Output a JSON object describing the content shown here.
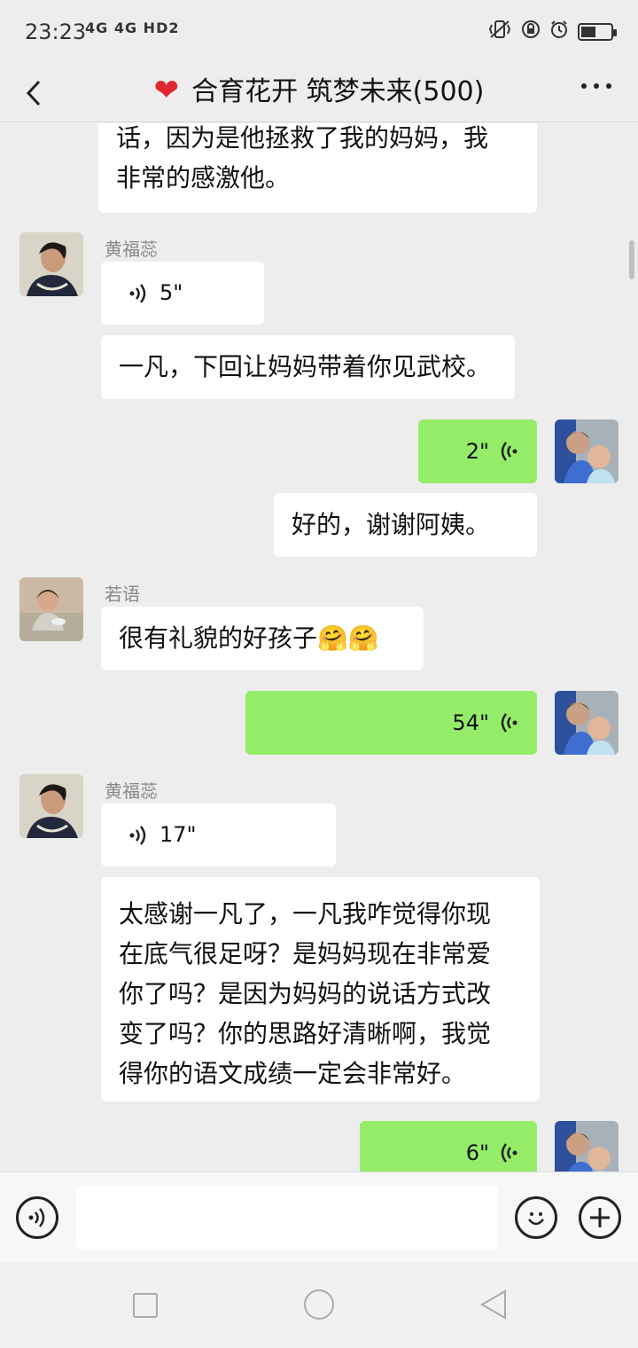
{
  "status_bar": {
    "time": "23:23",
    "network": "4G 4G HD2"
  },
  "header": {
    "title": "合育花开 筑梦未来(500)",
    "heart_icon": "red-heart-icon"
  },
  "messages": {
    "m0": {
      "line1": "话，因为是他拯救了我的妈妈，我",
      "line2": "非常的感激他。"
    },
    "m1": {
      "name": "黄福蕊",
      "duration": "5\""
    },
    "m2": {
      "text": "一凡，下回让妈妈带着你见武校。"
    },
    "m3": {
      "duration": "2\""
    },
    "m4": {
      "text": "好的，谢谢阿姨。"
    },
    "m5": {
      "name": "若语",
      "text": "很有礼貌的好孩子",
      "emoji": "🤗🤗"
    },
    "m6": {
      "duration": "54\""
    },
    "m7": {
      "name": "黄福蕊",
      "duration": "17\""
    },
    "m8": {
      "line1": "太感谢一凡了，一凡我咋觉得你现",
      "line2": "在底气很足呀？是妈妈现在非常爱",
      "line3": "你了吗？是因为妈妈的说话方式改",
      "line4": "变了吗？你的思路好清晰啊，我觉",
      "line5": "得你的语文成绩一定会非常好。"
    },
    "m9": {
      "duration": "6\""
    }
  },
  "input": {
    "value": ""
  },
  "colors": {
    "my_bubble": "#95ec69",
    "other_bubble": "#ffffff",
    "background": "#ededed"
  }
}
